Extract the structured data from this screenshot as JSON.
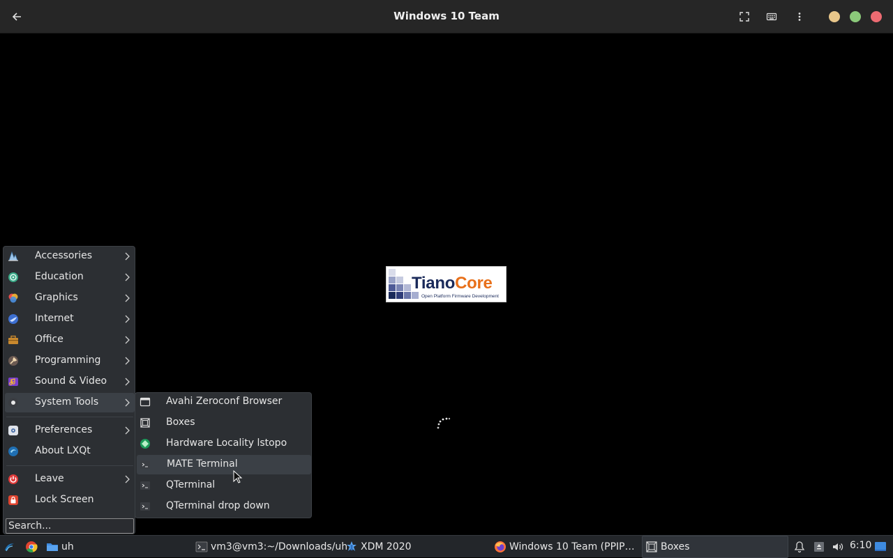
{
  "header": {
    "title": "Windows 10 Team",
    "back_icon": "back-arrow-icon",
    "fullscreen_icon": "fullscreen-icon",
    "keyboard_icon": "keyboard-icon",
    "menu_icon": "kebab-menu-icon",
    "window_controls": {
      "minimize_color": "#e8c68a",
      "maximize_color": "#8bc97a",
      "close_color": "#ec6b72"
    }
  },
  "guest": {
    "logo": {
      "word_part1": "Tiano",
      "word_part2": "Core",
      "tagline": "Open Platform Firmware Development"
    }
  },
  "menu": {
    "items": [
      {
        "label": "Accessories",
        "icon": "accessories-icon",
        "submenu": true
      },
      {
        "label": "Education",
        "icon": "education-icon",
        "submenu": true
      },
      {
        "label": "Graphics",
        "icon": "graphics-icon",
        "submenu": true
      },
      {
        "label": "Internet",
        "icon": "internet-icon",
        "submenu": true
      },
      {
        "label": "Office",
        "icon": "office-icon",
        "submenu": true
      },
      {
        "label": "Programming",
        "icon": "programming-icon",
        "submenu": true
      },
      {
        "label": "Sound & Video",
        "icon": "sound-video-icon",
        "submenu": true
      },
      {
        "label": "System Tools",
        "icon": "system-tools-icon",
        "submenu": true,
        "selected": true
      },
      {
        "label": "Preferences",
        "icon": "preferences-icon",
        "submenu": true
      },
      {
        "label": "About LXQt",
        "icon": "about-lxqt-icon",
        "submenu": false
      },
      {
        "label": "Leave",
        "icon": "leave-icon",
        "submenu": true
      },
      {
        "label": "Lock Screen",
        "icon": "lock-screen-icon",
        "submenu": false
      }
    ],
    "search_placeholder": "Search..."
  },
  "submenu": {
    "items": [
      {
        "label": "Avahi Zeroconf Browser",
        "icon": "avahi-icon"
      },
      {
        "label": "Boxes",
        "icon": "boxes-icon"
      },
      {
        "label": "Hardware Locality lstopo",
        "icon": "hwloc-icon"
      },
      {
        "label": "MATE Terminal",
        "icon": "terminal-icon",
        "highlighted": true
      },
      {
        "label": "QTerminal",
        "icon": "terminal-icon"
      },
      {
        "label": "QTerminal drop down",
        "icon": "terminal-icon"
      }
    ]
  },
  "taskbar": {
    "launcher_icon": "lxqt-start-icon",
    "quicklaunch": [
      {
        "label": "",
        "icon": "chrome-icon"
      },
      {
        "label": "uh",
        "icon": "folder-icon"
      }
    ],
    "tasks": [
      {
        "label": "vm3@vm3:~/Downloads/uh",
        "icon": "terminal-icon"
      },
      {
        "label": "XDM 2020",
        "icon": "xdm-icon"
      },
      {
        "label": "Windows 10 Team (PPIP…",
        "icon": "firefox-icon"
      },
      {
        "label": "Boxes",
        "icon": "boxes-icon",
        "active": true
      }
    ],
    "tray": {
      "clock": "6:10",
      "icons": [
        "notification-bell-icon",
        "drive-icon",
        "volume-icon",
        "show-desktop-icon"
      ]
    }
  }
}
